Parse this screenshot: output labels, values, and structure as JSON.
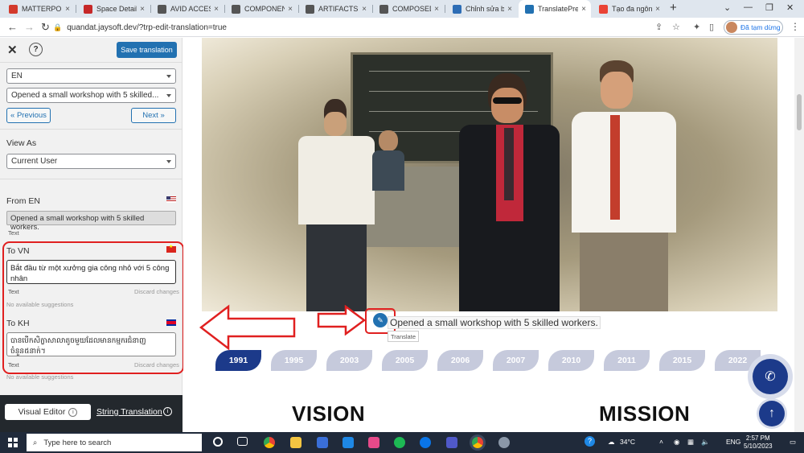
{
  "browser": {
    "tabs": [
      {
        "label": "MATTERPORT",
        "color": "#d33a2c"
      },
      {
        "label": "Space Detail",
        "color": "#c62828"
      },
      {
        "label": "AVID ACCESS",
        "color": "#555555"
      },
      {
        "label": "COMPONENT",
        "color": "#555555"
      },
      {
        "label": "ARTIFACTS FA",
        "color": "#555555"
      },
      {
        "label": "COMPOSED F",
        "color": "#555555"
      },
      {
        "label": "Chỉnh sửa bài",
        "color": "#2d6db5"
      },
      {
        "label": "TranslatePress",
        "color": "#2271b1"
      },
      {
        "label": "Tạo đa ngôn",
        "color": "#ea4335"
      }
    ],
    "new_tab": "+",
    "url": "quandat.jaysoft.dev/?trp-edit-translation=true",
    "profile_label": "Đã tạm dừng"
  },
  "panel": {
    "save_label": "Save translation",
    "language_selected": "EN",
    "string_selected": "Opened a small workshop with 5 skilled...",
    "prev_label": "« Previous",
    "next_label": "Next »",
    "view_as_label": "View As",
    "view_as_selected": "Current User",
    "from_label": "From EN",
    "source_text": "Opened a small workshop with 5 skilled workers.",
    "text_type": "Text",
    "to_vn_label": "To VN",
    "vn_translation": "Bắt đầu từ một xưởng gia công nhỏ với 5 công nhân",
    "discard_label": "Discard changes",
    "no_suggestions": "No available suggestions",
    "to_kh_label": "To KH",
    "kh_translation": "បានបើកសិក្ខាសាលាតូចមួយដែលមានកម្មករជំនាញចំនួន៥នាក់។",
    "visual_editor_label": "Visual Editor",
    "string_translation_label": "String Translation"
  },
  "content": {
    "caption": "Opened a small workshop with 5 skilled workers.",
    "tooltip": "Translate",
    "years": [
      "1991",
      "1995",
      "2003",
      "2005",
      "2006",
      "2007",
      "2010",
      "2011",
      "2015",
      "2022"
    ],
    "active_year": "1991",
    "vision": "VISION",
    "mission": "MISSION"
  },
  "taskbar": {
    "search_placeholder": "Type here to search",
    "weather": "34°C",
    "lang": "ENG",
    "time": "2:57 PM",
    "date": "5/10/2023"
  },
  "colors": {
    "primary": "#2271b1",
    "highlight": "#e02020",
    "timeline_active": "#1c3a8a",
    "timeline_inactive": "#c6cadc"
  }
}
